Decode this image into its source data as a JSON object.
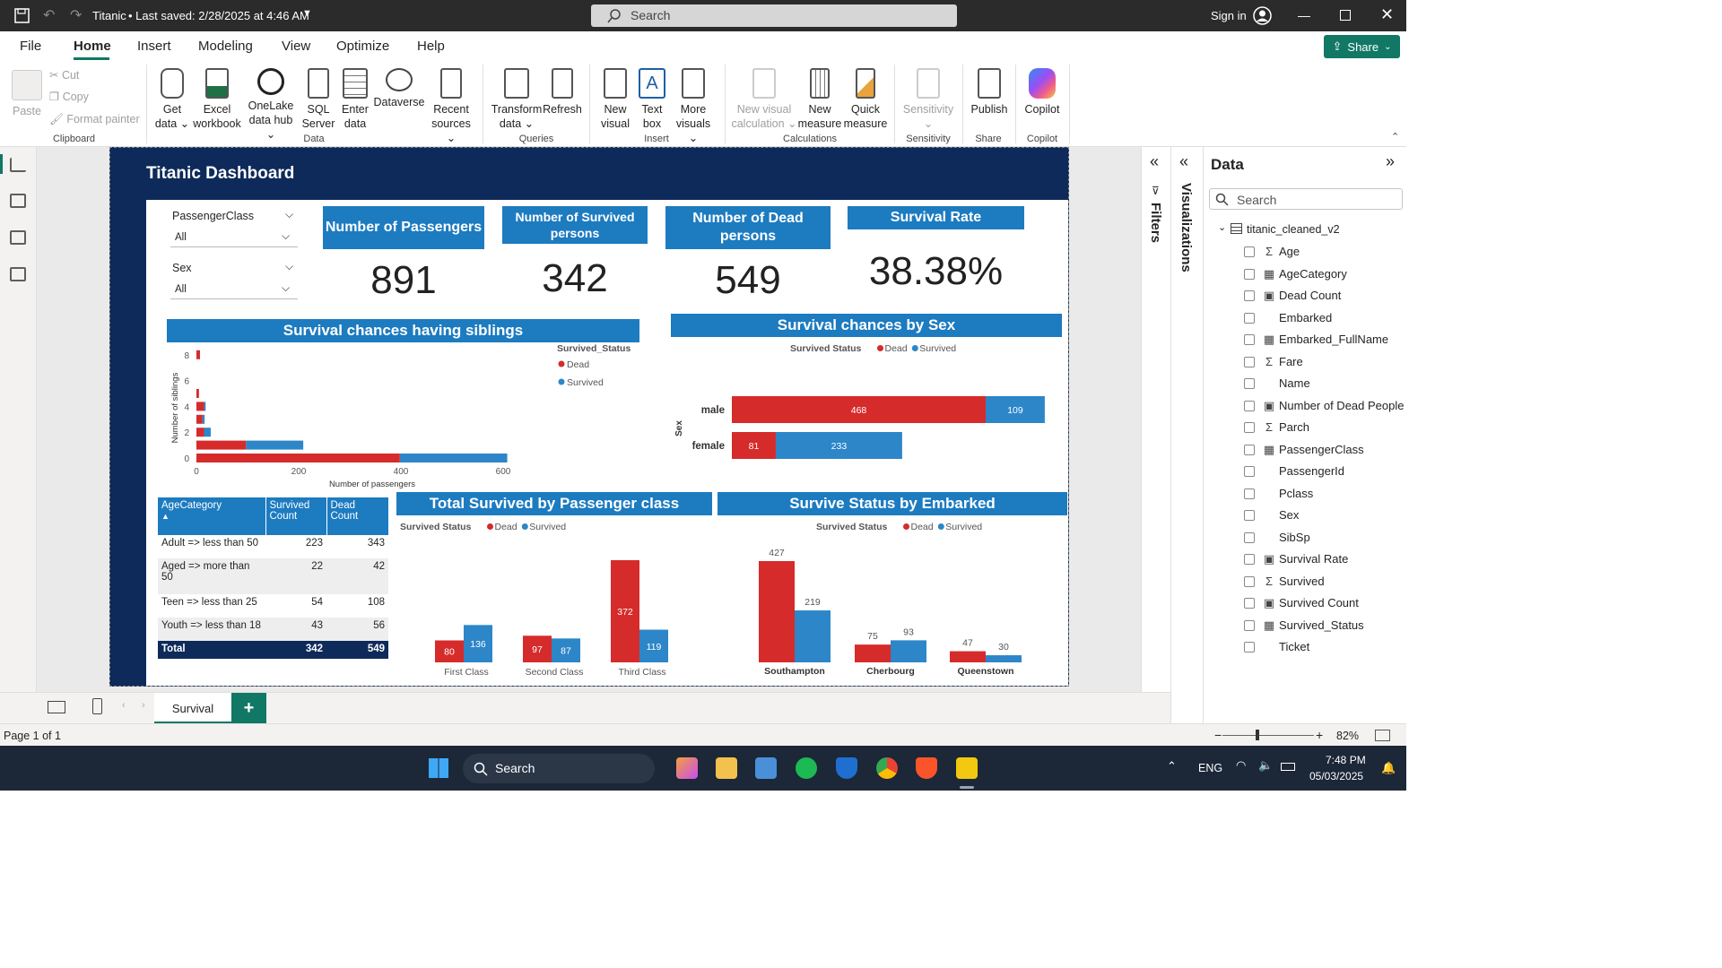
{
  "titlebar": {
    "doc_title": "Titanic",
    "saved": "• Last saved: 2/28/2025 at 4:46 AM",
    "search_placeholder": "Search",
    "sign_in": "Sign in"
  },
  "menu": {
    "items": [
      "File",
      "Home",
      "Insert",
      "Modeling",
      "View",
      "Optimize",
      "Help"
    ],
    "active": "Home",
    "share": "Share"
  },
  "ribbon": {
    "clipboard": {
      "paste": "Paste",
      "cut": "Cut",
      "copy": "Copy",
      "format_painter": "Format painter",
      "group": "Clipboard"
    },
    "data": {
      "buttons": [
        {
          "l1": "Get",
          "l2": "data ⌄"
        },
        {
          "l1": "Excel",
          "l2": "workbook"
        },
        {
          "l1": "OneLake",
          "l2": "data hub ⌄"
        },
        {
          "l1": "SQL",
          "l2": "Server"
        },
        {
          "l1": "Enter",
          "l2": "data"
        },
        {
          "l1": "Dataverse",
          "l2": ""
        },
        {
          "l1": "Recent",
          "l2": "sources ⌄"
        }
      ],
      "group": "Data"
    },
    "queries": {
      "transform_l1": "Transform",
      "transform_l2": "data ⌄",
      "refresh": "Refresh",
      "group": "Queries"
    },
    "insert": {
      "new_visual_l1": "New",
      "new_visual_l2": "visual",
      "text_box_l1": "Text",
      "text_box_l2": "box",
      "more_l1": "More",
      "more_l2": "visuals ⌄",
      "group": "Insert"
    },
    "calculations": {
      "nvc_l1": "New visual",
      "nvc_l2": "calculation ⌄",
      "nm_l1": "New",
      "nm_l2": "measure",
      "qm_l1": "Quick",
      "qm_l2": "measure",
      "group": "Calculations"
    },
    "sensitivity": {
      "label": "Sensitivity",
      "group": "Sensitivity"
    },
    "share": {
      "publish": "Publish",
      "group": "Share"
    },
    "copilot": {
      "label": "Copilot",
      "group": "Copilot"
    }
  },
  "report": {
    "title": "Titanic Dashboard",
    "slicers": [
      {
        "label": "PassengerClass",
        "value": "All"
      },
      {
        "label": "Sex",
        "value": "All"
      }
    ],
    "kpis": [
      {
        "title": "Number of Passengers",
        "value": "891"
      },
      {
        "title": "Number of Survived persons",
        "value": "342"
      },
      {
        "title": "Number of Dead persons",
        "value": "549"
      },
      {
        "title": "Survival Rate",
        "value": "38.38%"
      }
    ],
    "table": {
      "headers": [
        "AgeCategory",
        "Survived Count",
        "Dead Count"
      ],
      "rows": [
        [
          "Adult => less than 50",
          "223",
          "343"
        ],
        [
          "Aged => more than 50",
          "22",
          "42"
        ],
        [
          "Teen => less than 25",
          "54",
          "108"
        ],
        [
          "Youth => less than 18",
          "43",
          "56"
        ]
      ],
      "total": [
        "Total",
        "342",
        "549"
      ]
    }
  },
  "colors": {
    "dead": "#d62b2b",
    "survived": "#2d86c8",
    "header_blue": "#1d7bc0",
    "navy": "#0e2a5a"
  },
  "chart_data": [
    {
      "type": "bar",
      "orientation": "horizontal",
      "stacked": true,
      "title": "Survival chances having siblings",
      "xlabel": "Number of passengers",
      "ylabel": "Number of siblings",
      "legend_title": "Survived_Status",
      "legend_position": "top-right",
      "categories": [
        0,
        1,
        2,
        3,
        4,
        5,
        8
      ],
      "series": [
        {
          "name": "Dead",
          "values": [
            398,
            97,
            15,
            12,
            15,
            5,
            7
          ]
        },
        {
          "name": "Survived",
          "values": [
            210,
            112,
            13,
            4,
            3,
            0,
            0
          ]
        }
      ],
      "xlim": [
        0,
        650
      ],
      "xticks": [
        0,
        200,
        400,
        600
      ],
      "yticks": [
        0,
        2,
        4,
        6,
        8
      ]
    },
    {
      "type": "bar",
      "orientation": "horizontal",
      "stacked": true,
      "title": "Survival chances by Sex",
      "legend_title": "Survived Status",
      "legend_position": "top-center",
      "ylabel": "Sex",
      "categories": [
        "male",
        "female"
      ],
      "series": [
        {
          "name": "Dead",
          "values": [
            468,
            81
          ]
        },
        {
          "name": "Survived",
          "values": [
            109,
            233
          ]
        }
      ]
    },
    {
      "type": "bar",
      "title": "Total Survived by Passenger class",
      "legend_title": "Survived Status",
      "legend_position": "top-left",
      "categories": [
        "First Class",
        "Second Class",
        "Third Class"
      ],
      "series": [
        {
          "name": "Dead",
          "values": [
            80,
            97,
            372
          ]
        },
        {
          "name": "Survived",
          "values": [
            136,
            87,
            119
          ]
        }
      ]
    },
    {
      "type": "bar",
      "title": "Survive Status by Embarked",
      "legend_title": "Survived Status",
      "legend_position": "top-center",
      "categories": [
        "Southampton",
        "Cherbourg",
        "Queenstown"
      ],
      "series": [
        {
          "name": "Dead",
          "values": [
            427,
            75,
            47
          ]
        },
        {
          "name": "Survived",
          "values": [
            219,
            93,
            30
          ]
        }
      ]
    }
  ],
  "panes": {
    "filters": "Filters",
    "visualizations": "Visualizations",
    "data": {
      "title": "Data",
      "search_placeholder": "Search",
      "table_name": "titanic_cleaned_v2",
      "fields": [
        {
          "name": "Age",
          "icon": "sigma"
        },
        {
          "name": "AgeCategory",
          "icon": "calc-column"
        },
        {
          "name": "Dead Count",
          "icon": "measure"
        },
        {
          "name": "Embarked",
          "icon": "none"
        },
        {
          "name": "Embarked_FullName",
          "icon": "calc-column"
        },
        {
          "name": "Fare",
          "icon": "sigma"
        },
        {
          "name": "Name",
          "icon": "none"
        },
        {
          "name": "Number of Dead People",
          "icon": "measure"
        },
        {
          "name": "Parch",
          "icon": "sigma"
        },
        {
          "name": "PassengerClass",
          "icon": "calc-column"
        },
        {
          "name": "PassengerId",
          "icon": "none"
        },
        {
          "name": "Pclass",
          "icon": "none"
        },
        {
          "name": "Sex",
          "icon": "none"
        },
        {
          "name": "SibSp",
          "icon": "none"
        },
        {
          "name": "Survival Rate",
          "icon": "measure"
        },
        {
          "name": "Survived",
          "icon": "sigma"
        },
        {
          "name": "Survived Count",
          "icon": "measure"
        },
        {
          "name": "Survived_Status",
          "icon": "calc-column"
        },
        {
          "name": "Ticket",
          "icon": "none"
        }
      ]
    }
  },
  "pages": {
    "tab": "Survival",
    "add": "+"
  },
  "status": {
    "page": "Page 1 of 1",
    "zoom": "82%"
  },
  "taskbar": {
    "search": "Search",
    "lang": "ENG",
    "time": "7:48 PM",
    "date": "05/03/2025"
  }
}
